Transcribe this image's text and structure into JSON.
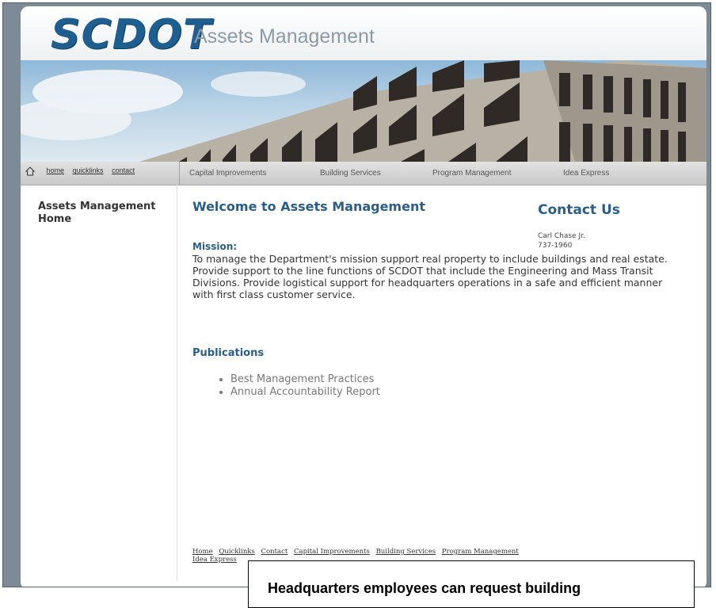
{
  "header": {
    "logo_text": "SCDOT",
    "site_title": "Assets Management"
  },
  "utility_nav": {
    "home_icon": "house-icon",
    "links": [
      "home",
      "quicklinks",
      "contact"
    ]
  },
  "main_nav": [
    "Capital Improvements",
    "Building Services",
    "Program Management",
    "Idea Express"
  ],
  "sidebar": {
    "title": "Assets Management Home"
  },
  "content": {
    "welcome_heading": "Welcome to Assets Management",
    "mission_label": "Mission:",
    "mission_text": "To manage the Department's mission support real property to include buildings and real estate. Provide support to the line functions of SCDOT that include the Engineering and Mass Transit Divisions. Provide logistical support for headquarters operations in a safe and efficient manner with first class customer service.",
    "publications_heading": "Publications",
    "publications": [
      "Best Management Practices",
      "Annual Accountability Report"
    ]
  },
  "contact": {
    "heading": "Contact Us",
    "name": "Carl Chase Jr.",
    "phone": "737-1960"
  },
  "footer_links": [
    "Home",
    "Quicklinks",
    "Contact",
    "Capital Improvements",
    "Building Services",
    "Program Management",
    "Idea Express"
  ],
  "overlay": {
    "caption": "Headquarters employees can request building"
  },
  "colors": {
    "brand_blue": "#2b5d86",
    "logo_blue": "#1f5f8f",
    "frame_gray": "#7d8b97"
  }
}
